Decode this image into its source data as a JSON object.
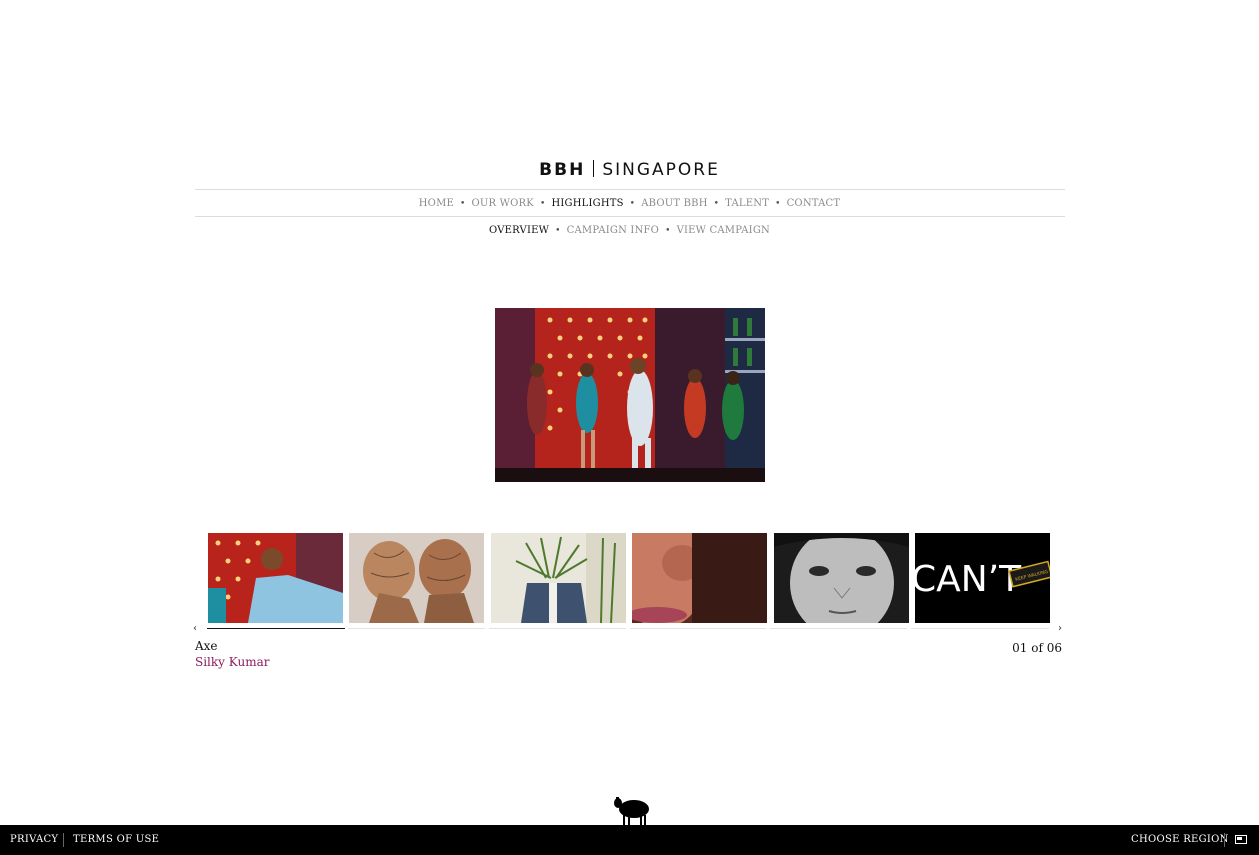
{
  "header": {
    "brand": "BBH",
    "region": "SINGAPORE"
  },
  "nav": {
    "items": [
      {
        "label": "HOME"
      },
      {
        "label": "OUR WORK"
      },
      {
        "label": "HIGHLIGHTS"
      },
      {
        "label": "ABOUT BBH"
      },
      {
        "label": "TALENT"
      },
      {
        "label": "CONTACT"
      }
    ],
    "active": "HIGHLIGHTS"
  },
  "subnav": {
    "items": [
      {
        "label": "OVERVIEW"
      },
      {
        "label": "CAMPAIGN INFO"
      },
      {
        "label": "VIEW CAMPAIGN"
      }
    ],
    "active": "OVERVIEW"
  },
  "carousel": {
    "current_client": "Axe",
    "current_title": "Silky Kumar",
    "counter": "01 of 06",
    "current_index": 1,
    "total": 6,
    "thumbnails": [
      {
        "subject": "dancer in blue suit on red lit backdrop"
      },
      {
        "subject": "two wooden sculpted heads facing"
      },
      {
        "subject": "denim jacket with plant"
      },
      {
        "subject": "close-up of nose and lips"
      },
      {
        "subject": "black and white face portrait"
      },
      {
        "subject": "CAN'T text on black"
      }
    ],
    "thumb6_text": "CAN’T",
    "thumb6_sign": "KEEP WALKING"
  },
  "footer": {
    "privacy": "PRIVACY",
    "terms": "TERMS OF USE",
    "region": "CHOOSE REGION"
  },
  "colors": {
    "footer_bg": "#000000",
    "caption_title": "#8a1a5c",
    "nav_inactive": "#8a8a8a",
    "nav_active": "#111111"
  }
}
